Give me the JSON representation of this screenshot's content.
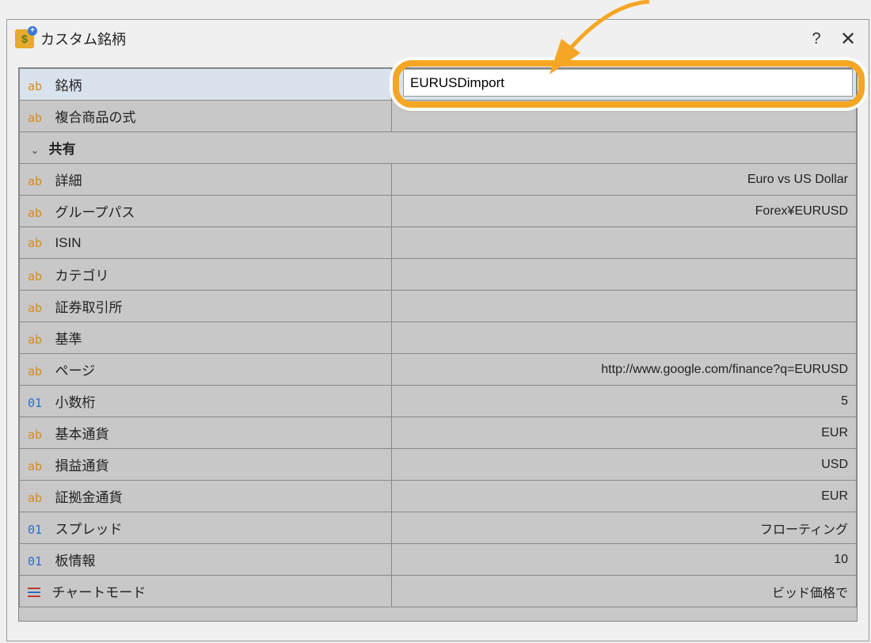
{
  "titlebar": {
    "title": "カスタム銘柄",
    "help": "?",
    "close": "✕"
  },
  "input": {
    "value": "EURUSDimport"
  },
  "group": {
    "label": "共有"
  },
  "rows": [
    {
      "type": "ab",
      "label": "銘柄",
      "value": "",
      "selected": true
    },
    {
      "type": "ab",
      "label": "複合商品の式",
      "value": ""
    },
    {
      "type": "ab",
      "label": "詳細",
      "value": "Euro vs US Dollar"
    },
    {
      "type": "ab",
      "label": "グループパス",
      "value": "Forex¥EURUSD"
    },
    {
      "type": "ab",
      "label": "ISIN",
      "value": ""
    },
    {
      "type": "ab",
      "label": "カテゴリ",
      "value": ""
    },
    {
      "type": "ab",
      "label": "証券取引所",
      "value": ""
    },
    {
      "type": "ab",
      "label": "基準",
      "value": ""
    },
    {
      "type": "ab",
      "label": "ページ",
      "value": "http://www.google.com/finance?q=EURUSD"
    },
    {
      "type": "01",
      "label": "小数桁",
      "value": "5"
    },
    {
      "type": "ab",
      "label": "基本通貨",
      "value": "EUR"
    },
    {
      "type": "ab",
      "label": "損益通貨",
      "value": "USD"
    },
    {
      "type": "ab",
      "label": "証拠金通貨",
      "value": "EUR"
    },
    {
      "type": "01",
      "label": "スプレッド",
      "value": "フローティング"
    },
    {
      "type": "01",
      "label": "板情報",
      "value": "10"
    },
    {
      "type": "menu",
      "label": "チャートモード",
      "value": "ビッド価格で"
    }
  ]
}
